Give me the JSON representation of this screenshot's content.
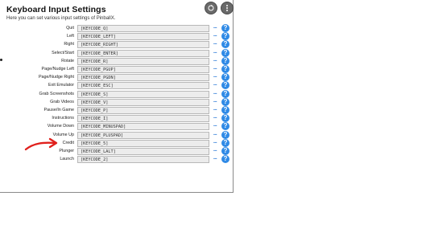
{
  "window": {
    "title": "Keyboard Input Settings",
    "subtitle": "Here you can set various input settings of PinballX."
  },
  "top_buttons": [
    {
      "icon": "refresh-icon"
    },
    {
      "icon": "more-vertical-icon"
    }
  ],
  "rows": [
    {
      "label": "Quit",
      "value": "[KEYCODE_Q]"
    },
    {
      "label": "Left",
      "value": "[KEYCODE_LEFT]"
    },
    {
      "label": "Right",
      "value": "[KEYCODE_RIGHT]"
    },
    {
      "label": "Select/Start",
      "value": "[KEYCODE_ENTER]"
    },
    {
      "label": "Rotate",
      "value": "[KEYCODE_R]"
    },
    {
      "label": "Page/Nudge Left",
      "value": "[KEYCODE_PGUP]"
    },
    {
      "label": "Page/Nudge Right",
      "value": "[KEYCODE_PGDN]"
    },
    {
      "label": "Exit Emulator",
      "value": "[KEYCODE_ESC]"
    },
    {
      "label": "Grab Screenshots",
      "value": "[KEYCODE_S]"
    },
    {
      "label": "Grab Videos",
      "value": "[KEYCODE_V]"
    },
    {
      "label": "Pause/In Game",
      "value": "[KEYCODE_P]"
    },
    {
      "label": "Instructions",
      "value": "[KEYCODE_I]"
    },
    {
      "label": "Volume Down",
      "value": "[KEYCODE_MINUSPAD]"
    },
    {
      "label": "Volume Up",
      "value": "[KEYCODE_PLUSPAD]"
    },
    {
      "label": "Credit",
      "value": "[KEYCODE_5]"
    },
    {
      "label": "Plunger",
      "value": "[KEYCODE_LALT]"
    },
    {
      "label": "Launch",
      "value": "[KEYCODE_2]"
    }
  ],
  "row_actions": {
    "more": "...",
    "help": "?"
  },
  "annotation": {
    "color": "#e0201c"
  },
  "colors": {
    "help": "#2f8ae6",
    "accent": "#2f7bd6"
  }
}
